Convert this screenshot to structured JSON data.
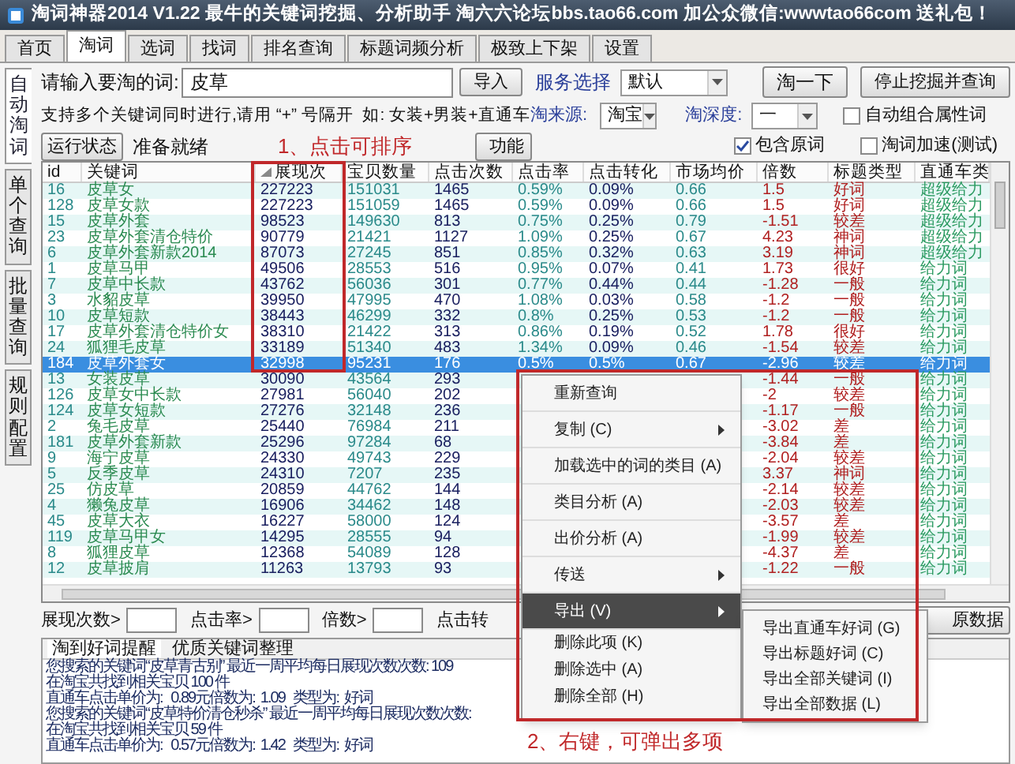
{
  "window": {
    "title": "淘词神器2014 V1.22 最牛的关键词挖掘、分析助手 淘六六论坛bbs.tao66.com 加公众微信:wwwtao66com 送礼包！"
  },
  "tabs": [
    {
      "label": "首页",
      "selected": false
    },
    {
      "label": "淘词",
      "selected": true
    },
    {
      "label": "选词",
      "selected": false
    },
    {
      "label": "找词",
      "selected": false
    },
    {
      "label": "排名查询",
      "selected": false
    },
    {
      "label": "标题词频分析",
      "selected": false
    },
    {
      "label": "极致上下架",
      "selected": false
    },
    {
      "label": "设置",
      "selected": false
    }
  ],
  "side_tabs": [
    {
      "label": "自动淘词",
      "selected": true
    },
    {
      "label": "单个查询",
      "selected": false
    },
    {
      "label": "批量查询",
      "selected": false
    },
    {
      "label": "规则配置",
      "selected": false
    }
  ],
  "search": {
    "label": "请输入要淘的词:",
    "value": "皮草",
    "import_button": "导入",
    "service_label": "服务选择",
    "service_value": "默认",
    "go_button": "淘一下",
    "stop_button": "停止挖掘并查询"
  },
  "hint": "支持多个关键词同时进行,请用 “+” 号隔开  如: 女装+男装+直通车",
  "source": {
    "label": "淘来源:",
    "value": "淘宝"
  },
  "depth": {
    "label": "淘深度:",
    "value": "一"
  },
  "options": [
    {
      "label": "自动组合属性词",
      "checked": false
    },
    {
      "label": "包含原词",
      "checked": true
    },
    {
      "label": "淘词加速(测试)",
      "checked": false
    }
  ],
  "status": {
    "button": "运行状态",
    "text": "准备就绪"
  },
  "function_button": "功能",
  "table": {
    "columns": [
      {
        "label": "id",
        "sorted": false
      },
      {
        "label": "关键词",
        "sorted": false
      },
      {
        "label": "展现次",
        "sorted": true
      },
      {
        "label": "宝贝数量",
        "sorted": false
      },
      {
        "label": "点击次数",
        "sorted": false
      },
      {
        "label": "点击率",
        "sorted": false
      },
      {
        "label": "点击转化",
        "sorted": false
      },
      {
        "label": "市场均价",
        "sorted": false
      },
      {
        "label": "倍数",
        "sorted": false
      },
      {
        "label": "标题类型",
        "sorted": false
      },
      {
        "label": "直通车类",
        "sorted": false
      }
    ],
    "rows": [
      {
        "id": "16",
        "keyword": "皮草女",
        "impressions": "227223",
        "items": "151031",
        "clicks": "1465",
        "ctr": "0.59%",
        "conversion": "0.09%",
        "price": "0.66",
        "multiple": "1.5",
        "title_type": "好词",
        "car_type": "超级给力",
        "selected": false
      },
      {
        "id": "128",
        "keyword": "皮草女款",
        "impressions": "227223",
        "items": "151059",
        "clicks": "1465",
        "ctr": "0.59%",
        "conversion": "0.09%",
        "price": "0.66",
        "multiple": "1.5",
        "title_type": "好词",
        "car_type": "超级给力",
        "selected": false
      },
      {
        "id": "15",
        "keyword": "皮草外套",
        "impressions": "98523",
        "items": "149630",
        "clicks": "813",
        "ctr": "0.75%",
        "conversion": "0.25%",
        "price": "0.79",
        "multiple": "-1.51",
        "title_type": "较差",
        "car_type": "超级给力",
        "selected": false
      },
      {
        "id": "23",
        "keyword": "皮草外套清仓特价",
        "impressions": "90779",
        "items": "21421",
        "clicks": "1127",
        "ctr": "1.09%",
        "conversion": "0.25%",
        "price": "0.67",
        "multiple": "4.23",
        "title_type": "神词",
        "car_type": "超级给力",
        "selected": false
      },
      {
        "id": "6",
        "keyword": "皮草外套新款2014",
        "impressions": "87073",
        "items": "27245",
        "clicks": "851",
        "ctr": "0.85%",
        "conversion": "0.32%",
        "price": "0.63",
        "multiple": "3.19",
        "title_type": "神词",
        "car_type": "超级给力",
        "selected": false
      },
      {
        "id": "1",
        "keyword": "皮草马甲",
        "impressions": "49506",
        "items": "28553",
        "clicks": "516",
        "ctr": "0.95%",
        "conversion": "0.07%",
        "price": "0.41",
        "multiple": "1.73",
        "title_type": "很好",
        "car_type": "给力词",
        "selected": false
      },
      {
        "id": "7",
        "keyword": "皮草中长款",
        "impressions": "43762",
        "items": "56036",
        "clicks": "301",
        "ctr": "0.77%",
        "conversion": "0.44%",
        "price": "0.44",
        "multiple": "-1.28",
        "title_type": "一般",
        "car_type": "给力词",
        "selected": false
      },
      {
        "id": "3",
        "keyword": "水貂皮草",
        "impressions": "39950",
        "items": "47995",
        "clicks": "470",
        "ctr": "1.08%",
        "conversion": "0.03%",
        "price": "0.58",
        "multiple": "-1.2",
        "title_type": "一般",
        "car_type": "给力词",
        "selected": false
      },
      {
        "id": "10",
        "keyword": "皮草短款",
        "impressions": "38443",
        "items": "46299",
        "clicks": "332",
        "ctr": "0.8%",
        "conversion": "0.25%",
        "price": "0.53",
        "multiple": "-1.2",
        "title_type": "一般",
        "car_type": "给力词",
        "selected": false
      },
      {
        "id": "17",
        "keyword": "皮草外套清仓特价女",
        "impressions": "38310",
        "items": "21422",
        "clicks": "313",
        "ctr": "0.86%",
        "conversion": "0.19%",
        "price": "0.52",
        "multiple": "1.78",
        "title_type": "很好",
        "car_type": "给力词",
        "selected": false
      },
      {
        "id": "24",
        "keyword": "狐狸毛皮草",
        "impressions": "33189",
        "items": "51340",
        "clicks": "483",
        "ctr": "1.34%",
        "conversion": "0.09%",
        "price": "0.46",
        "multiple": "-1.54",
        "title_type": "较差",
        "car_type": "给力词",
        "selected": false
      },
      {
        "id": "184",
        "keyword": "皮草外套女",
        "impressions": "32998",
        "items": "95231",
        "clicks": "176",
        "ctr": "0.5%",
        "conversion": "0.5%",
        "price": "0.67",
        "multiple": "-2.96",
        "title_type": "较差",
        "car_type": "给力词",
        "selected": true
      },
      {
        "id": "13",
        "keyword": "女装皮草",
        "impressions": "30090",
        "items": "43564",
        "clicks": "293",
        "multiple": "-1.44",
        "title_type": "一般",
        "car_type": "给力词",
        "selected": false
      },
      {
        "id": "126",
        "keyword": "皮草女中长款",
        "impressions": "27981",
        "items": "56040",
        "clicks": "202",
        "multiple": "-2",
        "title_type": "较差",
        "car_type": "给力词",
        "selected": false
      },
      {
        "id": "124",
        "keyword": "皮草女短款",
        "impressions": "27276",
        "items": "32148",
        "clicks": "236",
        "multiple": "-1.17",
        "title_type": "一般",
        "car_type": "给力词",
        "selected": false
      },
      {
        "id": "2",
        "keyword": "兔毛皮草",
        "impressions": "25440",
        "items": "76984",
        "clicks": "211",
        "multiple": "-3.02",
        "title_type": "差",
        "car_type": "给力词",
        "selected": false
      },
      {
        "id": "181",
        "keyword": "皮草外套新款",
        "impressions": "25296",
        "items": "97284",
        "clicks": "68",
        "multiple": "-3.84",
        "title_type": "差",
        "car_type": "给力词",
        "selected": false
      },
      {
        "id": "9",
        "keyword": "海宁皮草",
        "impressions": "24330",
        "items": "49743",
        "clicks": "229",
        "multiple": "-2.04",
        "title_type": "较差",
        "car_type": "给力词",
        "selected": false
      },
      {
        "id": "5",
        "keyword": "反季皮草",
        "impressions": "24310",
        "items": "7207",
        "clicks": "235",
        "multiple": "3.37",
        "title_type": "神词",
        "car_type": "给力词",
        "selected": false
      },
      {
        "id": "25",
        "keyword": "仿皮草",
        "impressions": "20859",
        "items": "44762",
        "clicks": "144",
        "multiple": "-2.14",
        "title_type": "较差",
        "car_type": "给力词",
        "selected": false
      },
      {
        "id": "4",
        "keyword": "獭兔皮草",
        "impressions": "16906",
        "items": "34462",
        "clicks": "148",
        "multiple": "-2.03",
        "title_type": "较差",
        "car_type": "给力词",
        "selected": false
      },
      {
        "id": "45",
        "keyword": "皮草大衣",
        "impressions": "16227",
        "items": "58000",
        "clicks": "124",
        "multiple": "-3.57",
        "title_type": "差",
        "car_type": "给力词",
        "selected": false
      },
      {
        "id": "119",
        "keyword": "皮草马甲女",
        "impressions": "14295",
        "items": "28555",
        "clicks": "94",
        "multiple": "-1.99",
        "title_type": "较差",
        "car_type": "给力词",
        "selected": false
      },
      {
        "id": "8",
        "keyword": "狐狸皮草",
        "impressions": "12368",
        "items": "54089",
        "clicks": "128",
        "multiple": "-4.37",
        "title_type": "差",
        "car_type": "给力词",
        "selected": false
      },
      {
        "id": "12",
        "keyword": "皮草披肩",
        "impressions": "11263",
        "items": "13793",
        "clicks": "93",
        "multiple": "-1.22",
        "title_type": "一般",
        "car_type": "给力词",
        "selected": false
      }
    ]
  },
  "filters": [
    {
      "label": "展现次数>"
    },
    {
      "label": "点击率>"
    },
    {
      "label": "倍数>"
    },
    {
      "label": "点击转"
    }
  ],
  "restore_button": "原数据",
  "log": {
    "tabs": [
      {
        "label": "淘到好词提醒",
        "selected": true
      },
      {
        "label": "优质关键词整理",
        "selected": false
      }
    ],
    "lines": [
      "您搜索的关键词“皮草青古别” 最近一周平均每日展现次数次数: 109",
      "在淘宝共找到相关宝贝 100 件",
      "直通车点击单价为:   0.89元倍数为:  1.09   类型为:  好词",
      "您搜索的关键词“皮草特价清仓秒杀” 最近一周平均每日展现次数次数:",
      "在淘宝共找到相关宝贝 59 件",
      "直通车点击单价为:   0.57元倍数为:  1.42   类型为:  好词"
    ]
  },
  "context_menu": {
    "items": [
      {
        "label": "重新查询",
        "submenu": false,
        "selected": false
      },
      {
        "label": "复制 (C)",
        "submenu": true,
        "selected": false
      },
      {
        "label": "加载选中的词的类目 (A)",
        "submenu": false,
        "selected": false
      },
      {
        "label": "类目分析 (A)",
        "submenu": false,
        "selected": false
      },
      {
        "label": "出价分析 (A)",
        "submenu": false,
        "selected": false
      },
      {
        "label": "传送",
        "submenu": true,
        "selected": false
      },
      {
        "label": "导出 (V)",
        "submenu": true,
        "selected": true
      },
      {
        "label": "删除此项 (K)",
        "submenu": false,
        "selected": false
      },
      {
        "label": "删除选中 (A)",
        "submenu": false,
        "selected": false
      },
      {
        "label": "删除全部 (H)",
        "submenu": false,
        "selected": false
      }
    ]
  },
  "submenu": {
    "items": [
      {
        "label": "导出直通车好词 (G)"
      },
      {
        "label": "导出标题好词 (C)"
      },
      {
        "label": "导出全部关键词 (I)"
      },
      {
        "label": "导出全部数据 (L)"
      }
    ]
  },
  "annotations": [
    "1、点击可排序",
    "2、右键，可弹出多项"
  ]
}
